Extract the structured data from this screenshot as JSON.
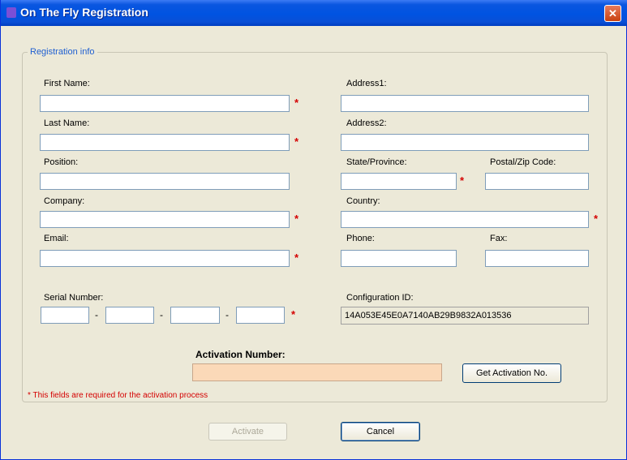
{
  "window": {
    "title": "On The Fly Registration",
    "close_glyph": "✕"
  },
  "group": {
    "legend": "Registration info"
  },
  "fields": {
    "first_name": {
      "label": "First Name:",
      "value": ""
    },
    "last_name": {
      "label": "Last Name:",
      "value": ""
    },
    "position": {
      "label": "Position:",
      "value": ""
    },
    "company": {
      "label": "Company:",
      "value": ""
    },
    "email": {
      "label": "Email:",
      "value": ""
    },
    "address1": {
      "label": "Address1:",
      "value": ""
    },
    "address2": {
      "label": "Address2:",
      "value": ""
    },
    "state": {
      "label": "State/Province:",
      "value": ""
    },
    "postal": {
      "label": "Postal/Zip Code:",
      "value": ""
    },
    "country": {
      "label": "Country:",
      "value": ""
    },
    "phone": {
      "label": "Phone:",
      "value": ""
    },
    "fax": {
      "label": "Fax:",
      "value": ""
    }
  },
  "serial": {
    "label": "Serial Number:",
    "separator": "-",
    "parts": [
      "",
      "",
      "",
      ""
    ]
  },
  "configuration": {
    "label": "Configuration ID:",
    "value": "14A053E45E0A7140AB29B9832A013536"
  },
  "activation": {
    "label": "Activation Number:",
    "value": "",
    "get_button": "Get Activation No."
  },
  "required_mark": "*",
  "required_note": "* This fields are required for the activation process",
  "buttons": {
    "activate": "Activate",
    "cancel": "Cancel"
  },
  "colors": {
    "title_bar": "#0053e1",
    "dialog_bg": "#ece9d8",
    "required": "#d40000",
    "activation_field": "#fbd9b8"
  },
  "icons": {
    "app": "app-icon",
    "close": "close-icon"
  }
}
